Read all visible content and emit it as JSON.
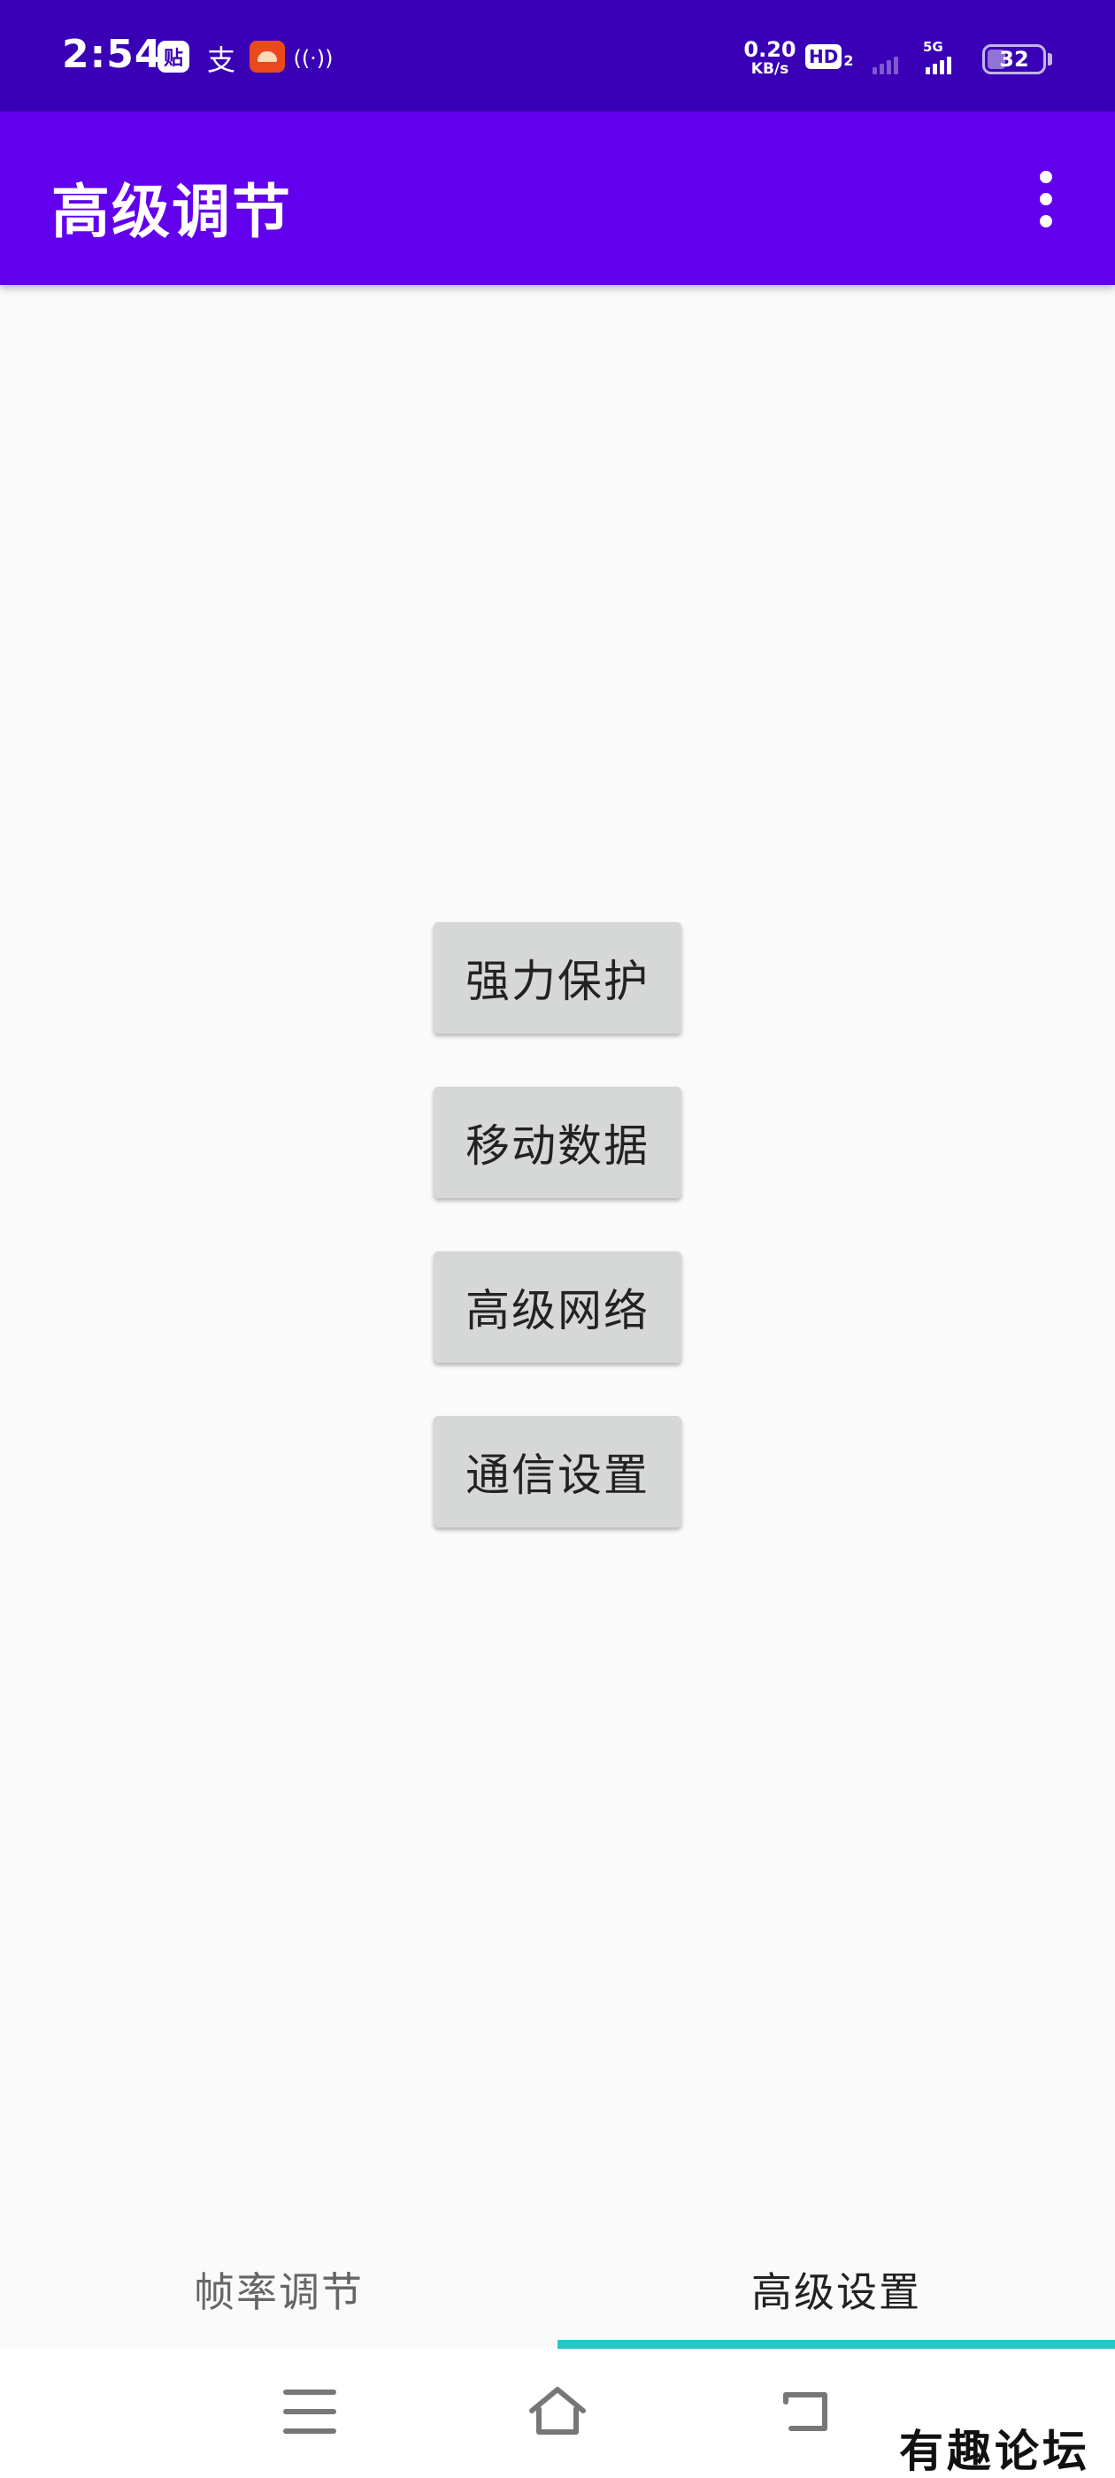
{
  "status_bar": {
    "time": "2:54",
    "notification_icons": [
      "tieba-icon",
      "alipay-icon",
      "app-icon",
      "hotspot-icon"
    ],
    "tieba_glyph": "贴",
    "alipay_glyph": "支",
    "hotspot_glyph": "((·))",
    "net_speed_value": "0.20",
    "net_speed_unit": "KB/s",
    "hd_label": "HD",
    "hd_sub": "2",
    "network_type": "5G",
    "battery_level": "32"
  },
  "app_bar": {
    "title": "高级调节"
  },
  "main": {
    "buttons": [
      {
        "label": "强力保护"
      },
      {
        "label": "移动数据"
      },
      {
        "label": "高级网络"
      },
      {
        "label": "通信设置"
      }
    ]
  },
  "tabs": [
    {
      "label": "帧率调节",
      "selected": false
    },
    {
      "label": "高级设置",
      "selected": true
    }
  ],
  "watermark": "有趣论坛",
  "colors": {
    "status_bar": "#3a00b6",
    "app_bar": "#6200ee",
    "tab_indicator": "#26c6c6",
    "button_bg": "#d6d7d7"
  }
}
